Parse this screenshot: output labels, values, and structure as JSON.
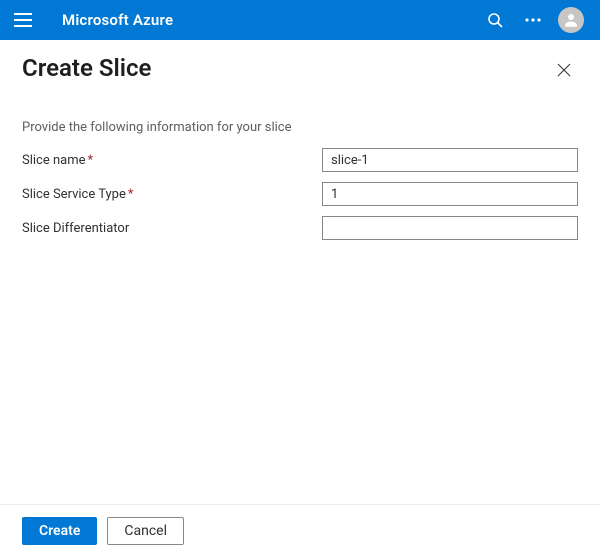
{
  "topbar": {
    "brand": "Microsoft Azure"
  },
  "blade": {
    "title": "Create Slice"
  },
  "form": {
    "intro": "Provide the following information for your slice",
    "fields": {
      "slice_name": {
        "label": "Slice name",
        "required_star": "*",
        "value": "slice-1"
      },
      "service_type": {
        "label": "Slice Service Type",
        "required_star": "*",
        "value": "1"
      },
      "differentiator": {
        "label": "Slice Differentiator",
        "value": ""
      }
    }
  },
  "footer": {
    "create": "Create",
    "cancel": "Cancel"
  }
}
